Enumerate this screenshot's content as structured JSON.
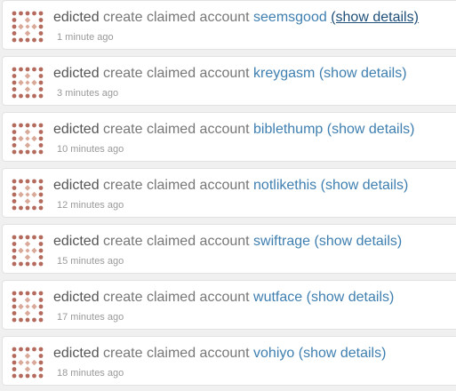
{
  "colors": {
    "avatar_dark": "#b46b5e",
    "avatar_light": "#d9a999",
    "link": "#3f7fb0",
    "text": "#777777",
    "card_bg": "#ffffff",
    "page_bg": "#f0f0f0"
  },
  "feed": {
    "items": [
      {
        "actor": "edicted",
        "operation": "create claimed account",
        "account": "seemsgood",
        "details_label": "(show details)",
        "time": "1 minute ago",
        "avatar_icon": "identicon-avatar"
      },
      {
        "actor": "edicted",
        "operation": "create claimed account",
        "account": "kreygasm",
        "details_label": "(show details)",
        "time": "3 minutes ago",
        "avatar_icon": "identicon-avatar"
      },
      {
        "actor": "edicted",
        "operation": "create claimed account",
        "account": "biblethump",
        "details_label": "(show details)",
        "time": "10 minutes ago",
        "avatar_icon": "identicon-avatar"
      },
      {
        "actor": "edicted",
        "operation": "create claimed account",
        "account": "notlikethis",
        "details_label": "(show details)",
        "time": "12 minutes ago",
        "avatar_icon": "identicon-avatar"
      },
      {
        "actor": "edicted",
        "operation": "create claimed account",
        "account": "swiftrage",
        "details_label": "(show details)",
        "time": "15 minutes ago",
        "avatar_icon": "identicon-avatar"
      },
      {
        "actor": "edicted",
        "operation": "create claimed account",
        "account": "wutface",
        "details_label": "(show details)",
        "time": "17 minutes ago",
        "avatar_icon": "identicon-avatar"
      },
      {
        "actor": "edicted",
        "operation": "create claimed account",
        "account": "vohiyo",
        "details_label": "(show details)",
        "time": "18 minutes ago",
        "avatar_icon": "identicon-avatar"
      }
    ]
  }
}
